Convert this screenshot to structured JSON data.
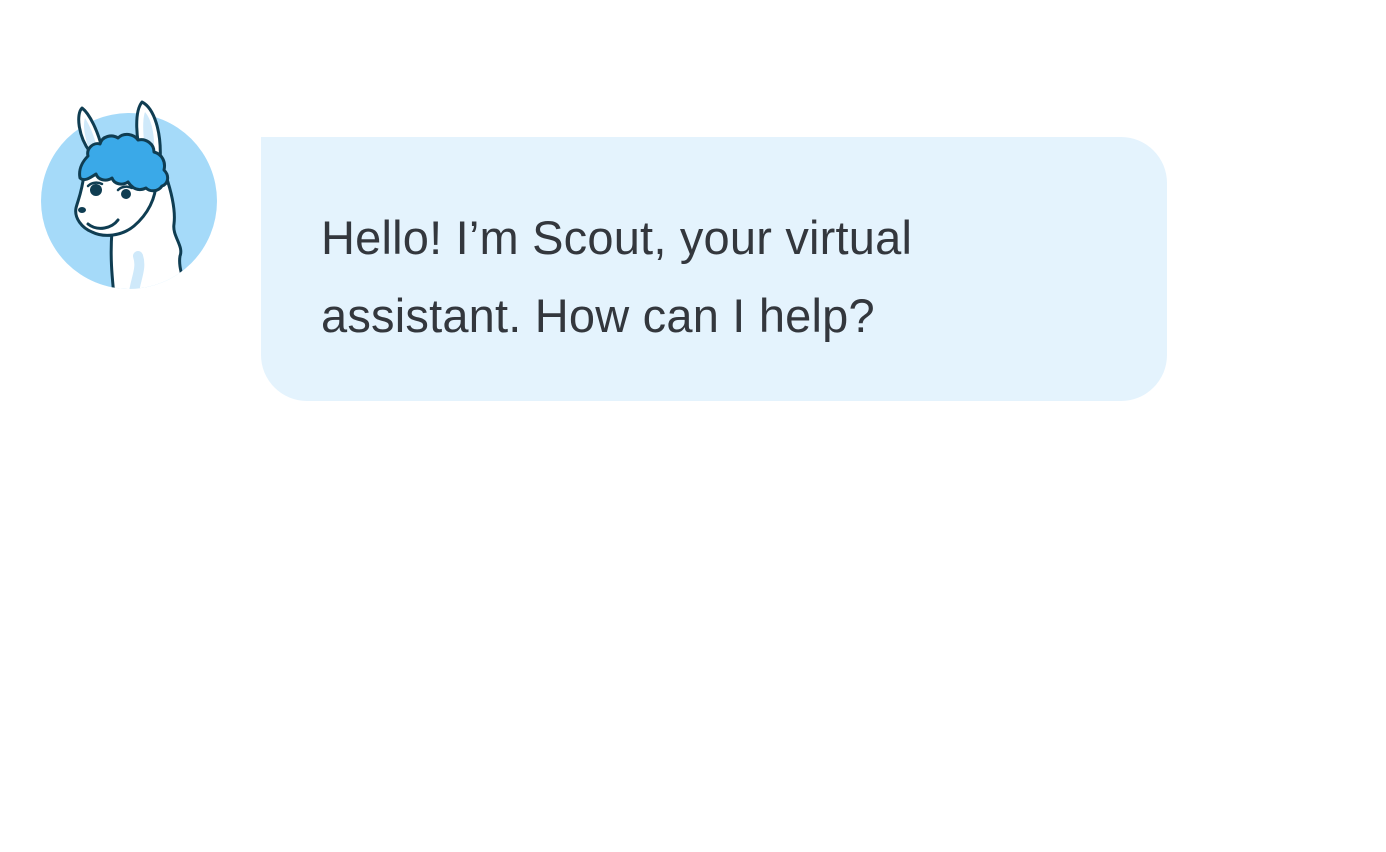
{
  "avatar": {
    "icon": "llama-mascot-icon",
    "circle_color": "#a5daf9",
    "hair_color": "#3aa9e8",
    "outline_color": "#0f3d52"
  },
  "message": {
    "text": "Hello! I’m Scout, your virtual\nassistant. How can I help?",
    "bubble_color": "#e4f3fd",
    "text_color": "#33373d"
  }
}
